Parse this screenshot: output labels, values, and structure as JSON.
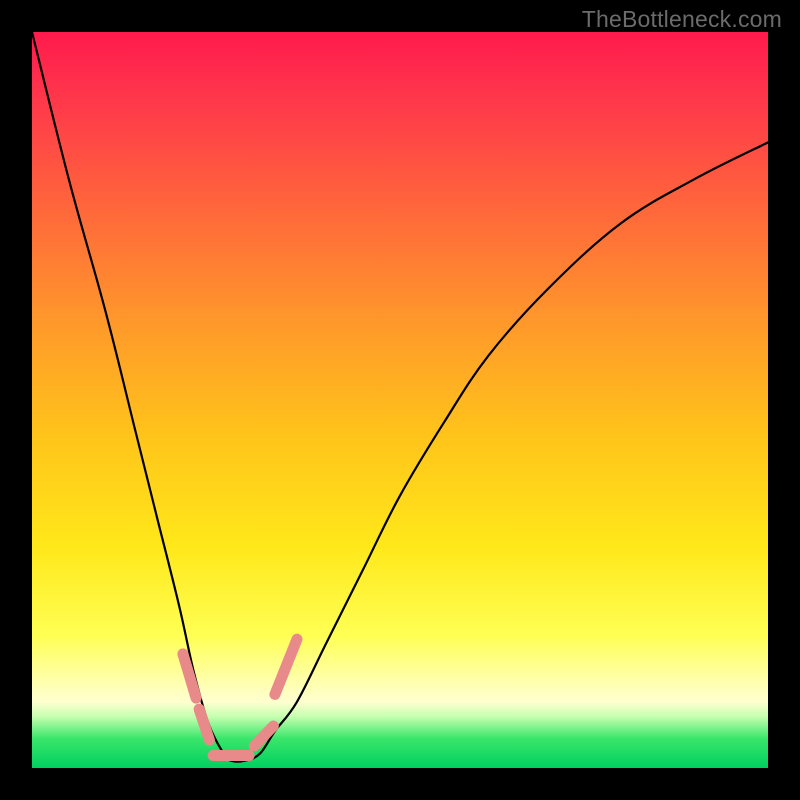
{
  "watermark": "TheBottleneck.com",
  "chart_data": {
    "type": "line",
    "title": "",
    "xlabel": "",
    "ylabel": "",
    "xlim": [
      0,
      100
    ],
    "ylim": [
      0,
      100
    ],
    "series": [
      {
        "name": "bottleneck-curve",
        "x": [
          0,
          5,
          10,
          14,
          17,
          20,
          22,
          24,
          26,
          27,
          29,
          31,
          33,
          36,
          40,
          45,
          50,
          56,
          62,
          70,
          80,
          90,
          100
        ],
        "values": [
          100,
          80,
          62,
          46,
          34,
          22,
          13,
          6,
          2,
          1,
          1,
          2,
          5,
          9,
          17,
          27,
          37,
          47,
          56,
          65,
          74,
          80,
          85
        ]
      }
    ],
    "markers": {
      "description": "salmon marker segments near curve minimum",
      "color": "#e88a8a",
      "segments": [
        {
          "x": [
            20.5,
            22.3
          ],
          "y": [
            15.5,
            9.5
          ]
        },
        {
          "x": [
            22.7,
            24.1
          ],
          "y": [
            8.0,
            3.8
          ]
        },
        {
          "x": [
            24.6,
            29.5
          ],
          "y": [
            1.7,
            1.7
          ]
        },
        {
          "x": [
            30.2,
            32.8
          ],
          "y": [
            3.0,
            5.7
          ]
        },
        {
          "x": [
            33.0,
            36.0
          ],
          "y": [
            10.0,
            17.5
          ]
        }
      ]
    },
    "background_gradient_stops": [
      {
        "pos": 0,
        "color": "#ff1a4d"
      },
      {
        "pos": 25,
        "color": "#ff6a3a"
      },
      {
        "pos": 55,
        "color": "#ffc41a"
      },
      {
        "pos": 82,
        "color": "#ffff54"
      },
      {
        "pos": 93,
        "color": "#c6ffb0"
      },
      {
        "pos": 100,
        "color": "#00d060"
      }
    ]
  }
}
